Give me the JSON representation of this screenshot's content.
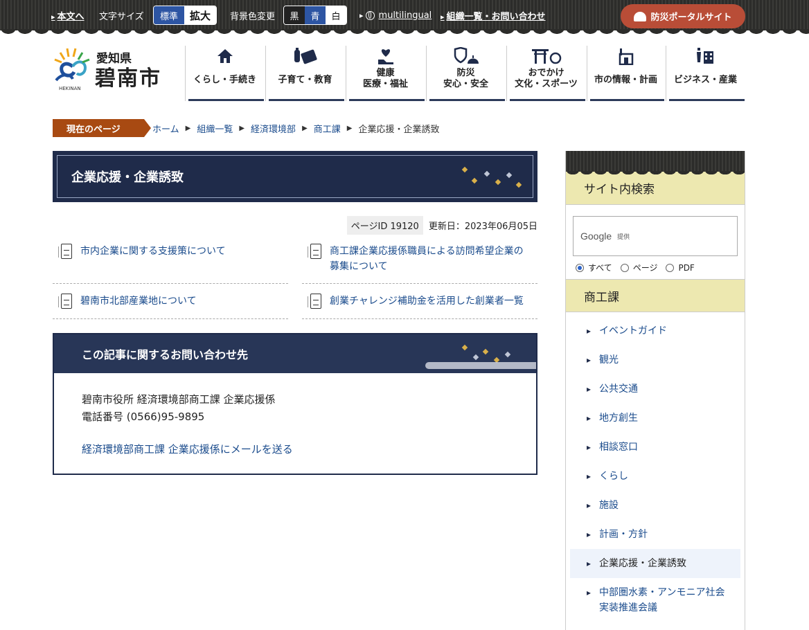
{
  "utility": {
    "skip": "本文へ",
    "font_size_label": "文字サイズ",
    "font_standard": "標準",
    "font_large": "拡大",
    "bg_label": "背景色変更",
    "bg_black": "黒",
    "bg_blue": "青",
    "bg_white": "白",
    "multilingual": "multilingual",
    "org_contact": "組織一覧・お問い合わせ",
    "disaster": "防災ポータルサイト"
  },
  "logo": {
    "pref": "愛知県",
    "city": "碧南市",
    "en": "HEKINAN"
  },
  "nav": [
    {
      "label1": "くらし・手続き",
      "label2": ""
    },
    {
      "label1": "子育て・教育",
      "label2": ""
    },
    {
      "label1": "健康",
      "label2": "医療・福祉"
    },
    {
      "label1": "防災",
      "label2": "安心・安全"
    },
    {
      "label1": "おでかけ",
      "label2": "文化・スポーツ"
    },
    {
      "label1": "市の情報・計画",
      "label2": ""
    },
    {
      "label1": "ビジネス・産業",
      "label2": ""
    }
  ],
  "breadcrumb": {
    "tag": "現在のページ",
    "items": [
      "ホーム",
      "組織一覧",
      "経済環境部",
      "商工課"
    ],
    "current": "企業応援・企業誘致"
  },
  "page": {
    "title": "企業応援・企業誘致",
    "page_id": "ページID 19120",
    "updated": "更新日：2023年06月05日"
  },
  "links": [
    {
      "line1": "市内企業に関する支援策について",
      "line2": ""
    },
    {
      "line1": "商工課企業応援係職員による訪問希望企業の",
      "line2": "募集について"
    },
    {
      "line1": "碧南市北部産業地について",
      "line2": ""
    },
    {
      "line1": "創業チャレンジ補助金を活用した創業者一覧",
      "line2": ""
    }
  ],
  "contact": {
    "heading": "この記事に関するお問い合わせ先",
    "office": "碧南市役所 経済環境部商工課 企業応援係",
    "phone": "電話番号 (0566)95-9895",
    "mail_link": "経済環境部商工課 企業応援係にメールを送る"
  },
  "sidebar": {
    "search_heading": "サイト内検索",
    "google": "Google",
    "provided": "提供",
    "radio_all": "すべて",
    "radio_page": "ページ",
    "radio_pdf": "PDF",
    "section_heading": "商工課",
    "items": [
      {
        "line1": "イベントガイド",
        "line2": ""
      },
      {
        "line1": "観光",
        "line2": ""
      },
      {
        "line1": "公共交通",
        "line2": ""
      },
      {
        "line1": "地方創生",
        "line2": ""
      },
      {
        "line1": "相談窓口",
        "line2": ""
      },
      {
        "line1": "くらし",
        "line2": ""
      },
      {
        "line1": "施設",
        "line2": ""
      },
      {
        "line1": "計画・方針",
        "line2": ""
      },
      {
        "line1": "企業応援・企業誘致",
        "line2": ""
      },
      {
        "line1": "中部圏水素・アンモニア社会",
        "line2": "実装推進会議"
      }
    ]
  },
  "colors": {
    "navy": "#1f2b4a",
    "crumb": "#a84a12",
    "disaster": "#b94d37",
    "side_head": "#ede8b0"
  }
}
